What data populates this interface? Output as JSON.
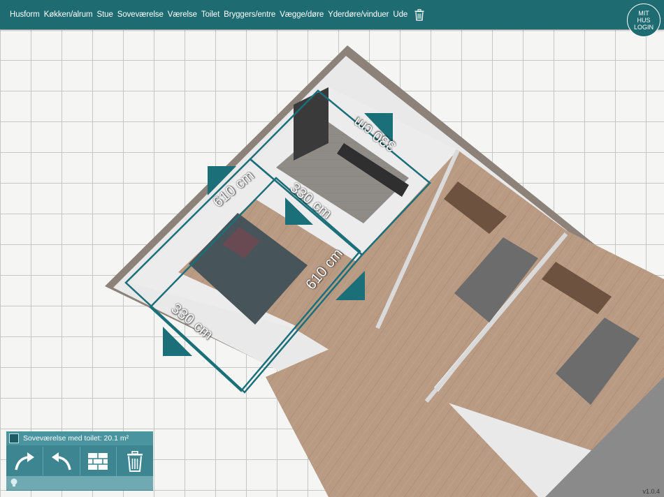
{
  "menu": {
    "items": [
      "Husform",
      "Køkken/alrum",
      "Stue",
      "Soveværelse",
      "Værelse",
      "Toilet",
      "Bryggers/entre",
      "Vægge/døre",
      "Yderdøre/vinduer",
      "Ude"
    ],
    "trash_icon": "trash-icon"
  },
  "login": {
    "line1": "MIT",
    "line2": "HUS",
    "line3": "LOGIN"
  },
  "dimensions": {
    "top_right": "330 cm",
    "top_left": "610 cm",
    "mid": "330 cm",
    "right": "610 cm",
    "bottom": "330 cm"
  },
  "panel": {
    "room_label": "Soveværelse med toilet: 20.1 m²",
    "tools": [
      "rotate-right-icon",
      "rotate-left-icon",
      "wall-icon",
      "trash-icon"
    ],
    "hint_icon": "lightbulb-icon"
  },
  "version": "v1.0.4",
  "colors": {
    "accent": "#1e6b72",
    "panel": "#3d8590",
    "floor": "#b99a83",
    "wall": "#e6e6e6"
  }
}
